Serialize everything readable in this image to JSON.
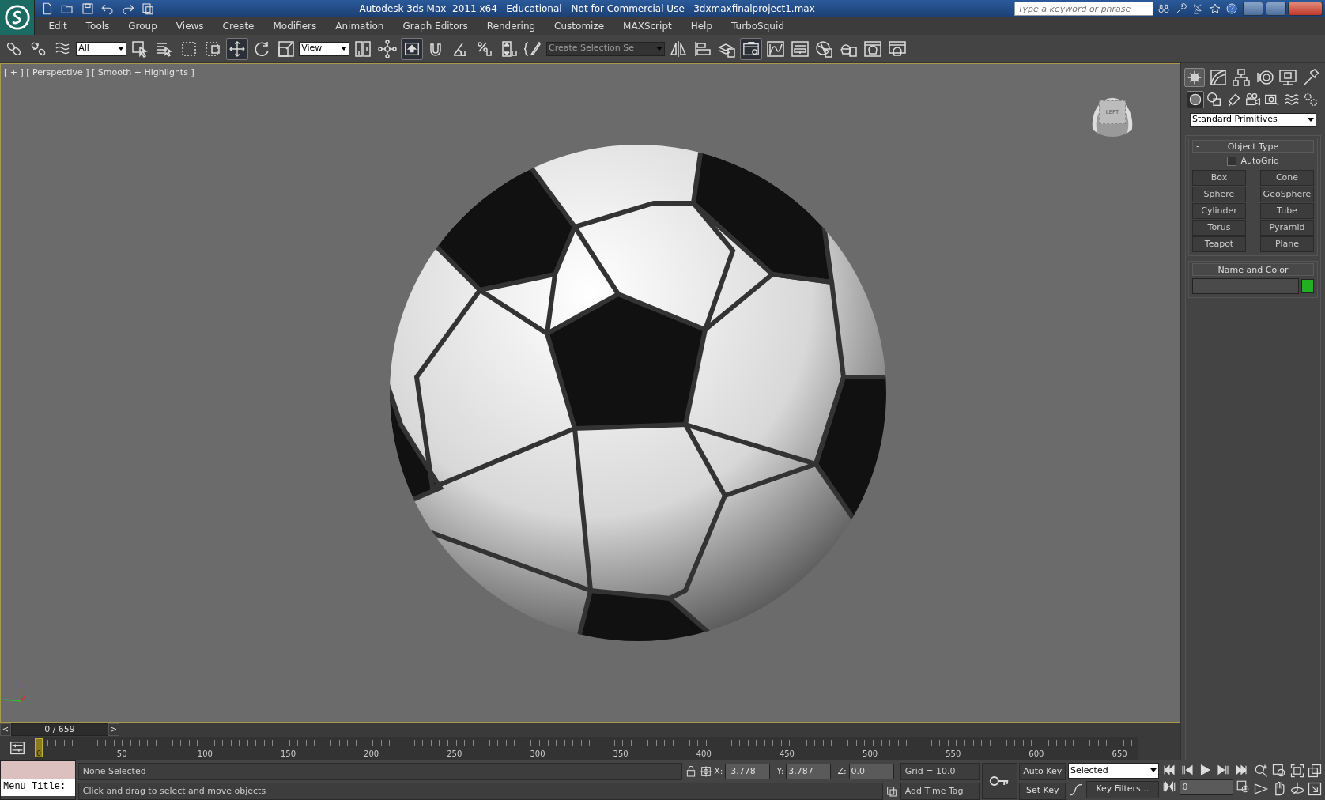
{
  "title_bar": {
    "title": "Autodesk 3ds Max  2011 x64   Educational - Not for Commercial Use   3dxmaxfinalproject1.max",
    "search": {
      "placeholder": "Type a keyword or phrase"
    }
  },
  "menu": [
    "Edit",
    "Tools",
    "Group",
    "Views",
    "Create",
    "Modifiers",
    "Animation",
    "Graph Editors",
    "Rendering",
    "Customize",
    "MAXScript",
    "Help",
    "TurboSquid"
  ],
  "toolbar": {
    "selection_filter": "All",
    "reference_coord": "View",
    "named_selection": "Create Selection Se"
  },
  "viewport": {
    "label": "[ + ] [ Perspective ] [ Smooth + Highlights ]",
    "viewcube_face": "LEFT"
  },
  "command_panel": {
    "tabs": [
      {
        "selected": true
      },
      {
        "selected": false
      },
      {
        "selected": false
      },
      {
        "selected": false
      },
      {
        "selected": false
      },
      {
        "selected": false
      }
    ],
    "categories": [
      {
        "selected": true
      },
      {
        "selected": false
      },
      {
        "selected": false
      },
      {
        "selected": false
      },
      {
        "selected": false
      },
      {
        "selected": false
      },
      {
        "selected": false
      }
    ],
    "dropdown": "Standard Primitives",
    "object_type": {
      "toggle": "-",
      "title": "Object Type",
      "autogrid": {
        "label": "AutoGrid",
        "checked": false
      },
      "buttons": [
        "Box",
        "Cone",
        "Sphere",
        "GeoSphere",
        "Cylinder",
        "Tube",
        "Torus",
        "Pyramid",
        "Teapot",
        "Plane"
      ]
    },
    "name_and_color": {
      "toggle": "-",
      "title": "Name and Color",
      "color": "#22b022"
    }
  },
  "time_slider": {
    "prev": "<",
    "position": "0 / 659",
    "next": ">"
  },
  "track_bar": {
    "marker": "0",
    "ticks": [
      "50",
      "100",
      "150",
      "200",
      "250",
      "300",
      "350",
      "400",
      "450",
      "500",
      "550",
      "600",
      "650"
    ]
  },
  "status": {
    "listener": "Menu Title:",
    "selection": "None Selected",
    "prompt": "Click and drag to select and move objects",
    "coords": [
      {
        "label": "X:",
        "value": "-3.778"
      },
      {
        "label": "Y:",
        "value": "3.787"
      },
      {
        "label": "Z:",
        "value": "0.0"
      }
    ],
    "grid": "Grid = 10.0",
    "time_tag": "Add Time Tag",
    "auto_key": "Auto Key",
    "key_mode": "Selected",
    "set_key": "Set Key",
    "key_filters": "Key Filters...",
    "frame": "0"
  }
}
